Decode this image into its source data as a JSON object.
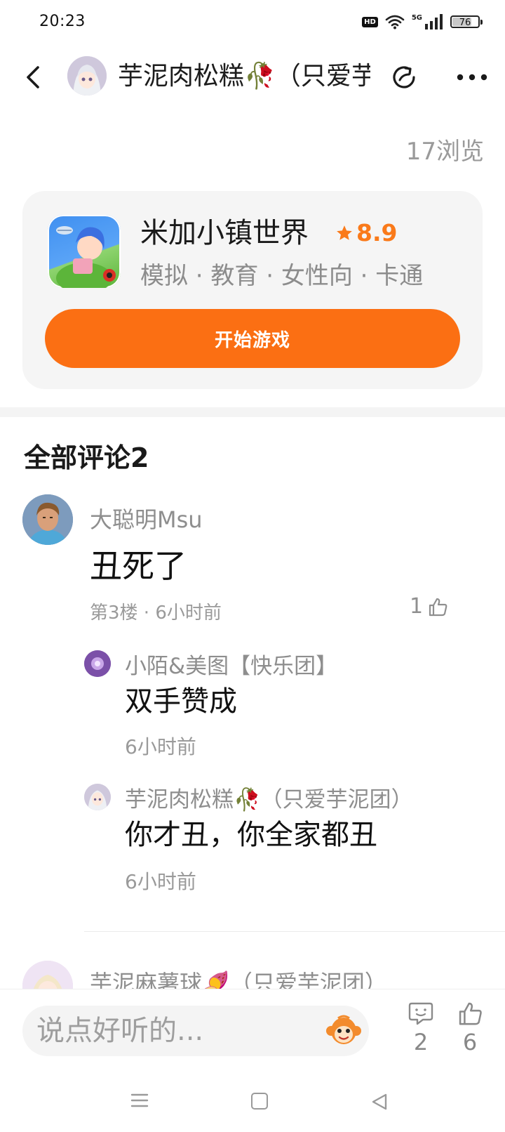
{
  "status_bar": {
    "time": "20:23",
    "hd": "HD",
    "network": "5G",
    "battery": "76",
    "battery_level": 0.76
  },
  "header": {
    "title": "芋泥肉松糕🥀（只爱芋泥团）",
    "avatar_icon": "anime-avatar",
    "back_icon": "chevron-left-icon",
    "share_icon": "share-icon",
    "more_icon": "more-dots-icon"
  },
  "post": {
    "views": "17浏览"
  },
  "game_card": {
    "name": "米加小镇世界",
    "rating": "8.9",
    "tags": "模拟 · 教育 · 女性向 · 卡通",
    "play_label": "开始游戏",
    "accent": "#fb6f13"
  },
  "comments": {
    "section_title": "全部评论2",
    "items": [
      {
        "user": "大聪明Msu",
        "text": "丑死了",
        "meta": "第3楼 · 6小时前",
        "likes": "1",
        "replies": [
          {
            "user": "小陌&美图【快乐团】",
            "text": "双手赞成",
            "time": "6小时前"
          },
          {
            "user": "芋泥肉松糕🥀（只爱芋泥团）",
            "text": "你才丑，你全家都丑",
            "time": "6小时前"
          }
        ]
      },
      {
        "user": "芋泥麻薯球🍠（只爱芋泥团）"
      }
    ]
  },
  "bottom_bar": {
    "input_placeholder": "说点好听的...",
    "comment_count": "2",
    "like_count": "6"
  }
}
